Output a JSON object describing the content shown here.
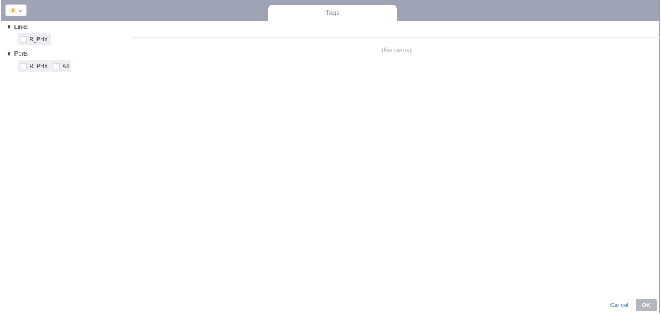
{
  "toolbar": {
    "favorites_icon": "star-icon",
    "dropdown_icon": "chevron-down-icon",
    "accent_color": "#f0b428"
  },
  "tab": {
    "label": "Tags"
  },
  "tree": {
    "groups": [
      {
        "label": "Links",
        "items": [
          {
            "label": "R_PHY",
            "checked": false
          }
        ]
      },
      {
        "label": "Ports",
        "items": [
          {
            "label": "R_PHY",
            "checked": false
          },
          {
            "label": "All",
            "checked": false
          }
        ]
      }
    ]
  },
  "main": {
    "empty_text": "(No items)"
  },
  "footer": {
    "cancel_label": "Cancel",
    "ok_label": "OK",
    "link_color": "#3a7ec8"
  }
}
